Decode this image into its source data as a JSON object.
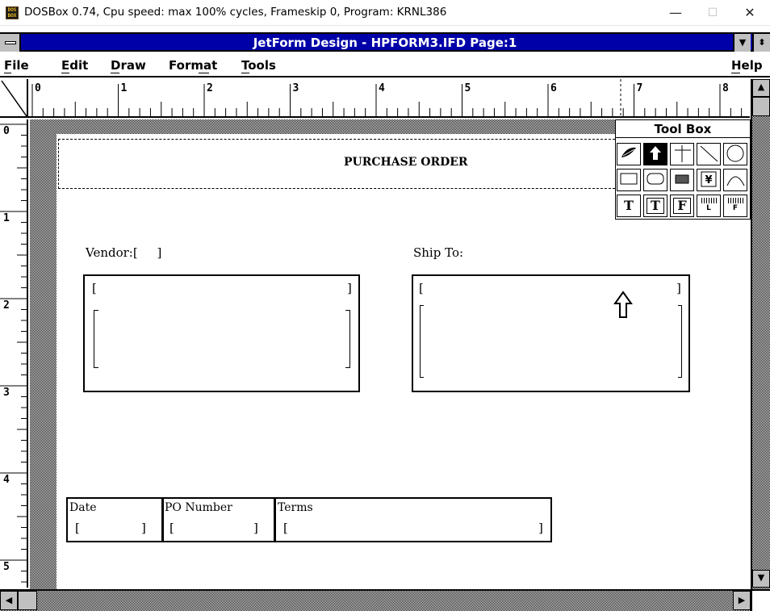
{
  "host": {
    "title": "DOSBox 0.74, Cpu speed: max 100% cycles, Frameskip  0, Program:  KRNL386",
    "icon": "dosbox-icon",
    "minimize": "—",
    "maximize": "☐",
    "close": "✕"
  },
  "app": {
    "title": "JetForm Design - HPFORM3.IFD Page:1",
    "title_bar_color": "#0000a8"
  },
  "menu": {
    "file": "File",
    "edit": "Edit",
    "draw": "Draw",
    "format": "Format",
    "tools": "Tools",
    "help": "Help"
  },
  "ruler": {
    "h": [
      "0",
      "1",
      "2",
      "3",
      "4",
      "5",
      "6",
      "7",
      "8"
    ],
    "v": [
      "0",
      "1",
      "2",
      "3",
      "4",
      "5"
    ]
  },
  "form": {
    "header_title": "PURCHASE ORDER",
    "vendor_label": "Vendor:[     ]",
    "shipto_label": "Ship To:",
    "vendor_line1_l": "[",
    "vendor_line1_r": "]",
    "shipto_line1_l": "[",
    "shipto_line1_r": "]",
    "date_label": "Date",
    "date_field_l": "[",
    "date_field_r": "]",
    "po_label": "PO Number",
    "po_field_l": "[",
    "po_field_r": "]",
    "terms_label": "Terms",
    "terms_field_l": "[",
    "terms_field_r": "]"
  },
  "toolbox": {
    "title": "Tool Box",
    "tools": [
      "brush-icon",
      "pointer-icon",
      "cross-line-icon",
      "diagonal-line-icon",
      "circle-icon",
      "rectangle-icon",
      "rounded-rectangle-icon",
      "hatched-box-icon",
      "graphic-icon",
      "arc-icon",
      "T",
      "T",
      "F",
      "L",
      "F"
    ]
  }
}
